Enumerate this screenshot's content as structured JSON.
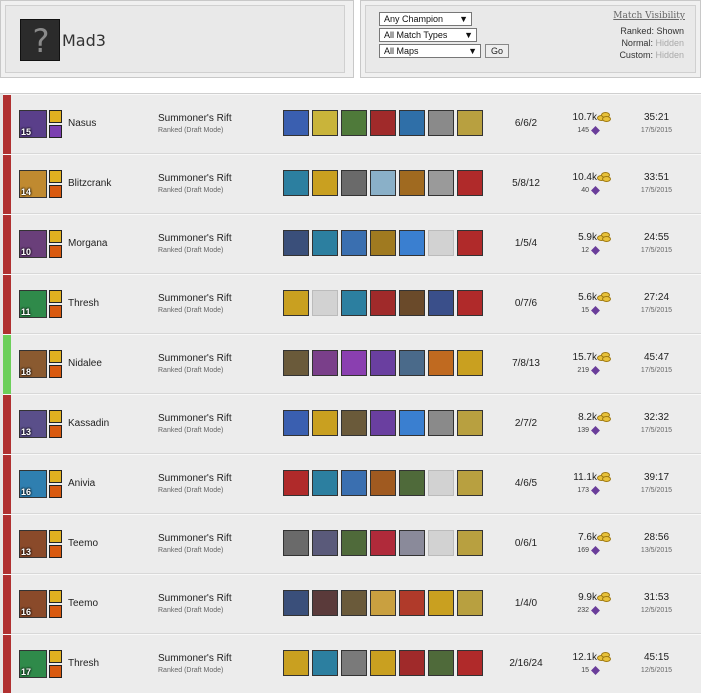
{
  "profile": {
    "name": "Mad3",
    "avatar_icon": "question-mark-icon"
  },
  "filters": {
    "champion": "Any Champion",
    "match_types": "All Match Types",
    "maps": "All Maps",
    "go_label": "Go"
  },
  "visibility": {
    "title": "Match Visibility",
    "ranked_label": "Ranked:",
    "ranked_value": "Shown",
    "normal_label": "Normal:",
    "normal_value": "Hidden",
    "custom_label": "Custom:",
    "custom_value": "Hidden"
  },
  "colors": {
    "loss": "#b03030",
    "win": "#6ccf5a"
  },
  "matches": [
    {
      "result": "loss",
      "champion": "Nasus",
      "level": "15",
      "mode": "Summoner's Rift",
      "queue": "Ranked (Draft Mode)",
      "kda": "6/6/2",
      "gold": "10.7k",
      "cs": "145",
      "duration": "35:21",
      "date": "17/5/2015",
      "champ_color": "#5a3f8a",
      "spells": [
        "#e0b020",
        "#7b3fb0"
      ],
      "items": [
        "#3a5fb0",
        "#c9b43a",
        "#4f7a3a",
        "#a02a2a",
        "#2f6fa8",
        "#8a8a8a",
        "#b8a040"
      ]
    },
    {
      "result": "loss",
      "champion": "Blitzcrank",
      "level": "14",
      "mode": "Summoner's Rift",
      "queue": "Ranked (Draft Mode)",
      "kda": "5/8/12",
      "gold": "10.4k",
      "cs": "40",
      "duration": "33:51",
      "date": "17/5/2015",
      "champ_color": "#c08a30",
      "spells": [
        "#e0b020",
        "#d85a10"
      ],
      "items": [
        "#2c7fa0",
        "#c9a020",
        "#6a6a6a",
        "#8ab0c8",
        "#a06a20",
        "#9a9a9a",
        "#b02a2a"
      ]
    },
    {
      "result": "loss",
      "champion": "Morgana",
      "level": "10",
      "mode": "Summoner's Rift",
      "queue": "Ranked (Draft Mode)",
      "kda": "1/5/4",
      "gold": "5.9k",
      "cs": "12",
      "duration": "24:55",
      "date": "17/5/2015",
      "champ_color": "#6a3f7a",
      "spells": [
        "#e0b020",
        "#d85a10"
      ],
      "items": [
        "#3a4f7a",
        "#2c7fa0",
        "#3a6fb0",
        "#a07a20",
        "#3a7fd0",
        null,
        "#b02a2a"
      ]
    },
    {
      "result": "loss",
      "champion": "Thresh",
      "level": "11",
      "mode": "Summoner's Rift",
      "queue": "Ranked (Draft Mode)",
      "kda": "0/7/6",
      "gold": "5.6k",
      "cs": "15",
      "duration": "27:24",
      "date": "17/5/2015",
      "champ_color": "#2f8a4a",
      "spells": [
        "#e0b020",
        "#d85a10"
      ],
      "items": [
        "#c9a020",
        null,
        "#2c7fa0",
        "#a02a2a",
        "#6a4a2a",
        "#3a4f8a",
        "#b02a2a"
      ]
    },
    {
      "result": "win",
      "champion": "Nidalee",
      "level": "18",
      "mode": "Summoner's Rift",
      "queue": "Ranked (Draft Mode)",
      "kda": "7/8/13",
      "gold": "15.7k",
      "cs": "219",
      "duration": "45:47",
      "date": "17/5/2015",
      "champ_color": "#8a5a30",
      "spells": [
        "#e0b020",
        "#d85a10"
      ],
      "items": [
        "#6a5a3a",
        "#7a3f8a",
        "#8a3fb0",
        "#6a3fa0",
        "#4a6a8a",
        "#c06a20",
        "#c9a020"
      ]
    },
    {
      "result": "loss",
      "champion": "Kassadin",
      "level": "13",
      "mode": "Summoner's Rift",
      "queue": "Ranked (Draft Mode)",
      "kda": "2/7/2",
      "gold": "8.2k",
      "cs": "139",
      "duration": "32:32",
      "date": "17/5/2015",
      "champ_color": "#5a4f8a",
      "spells": [
        "#e0b020",
        "#d85a10"
      ],
      "items": [
        "#3a5fb0",
        "#c9a020",
        "#6a5a3a",
        "#6a3fa0",
        "#3a7fd0",
        "#8a8a8a",
        "#b8a040"
      ]
    },
    {
      "result": "loss",
      "champion": "Anivia",
      "level": "16",
      "mode": "Summoner's Rift",
      "queue": "Ranked (Draft Mode)",
      "kda": "4/6/5",
      "gold": "11.1k",
      "cs": "173",
      "duration": "39:17",
      "date": "17/5/2015",
      "champ_color": "#2f7fb0",
      "spells": [
        "#e0b020",
        "#d85a10"
      ],
      "items": [
        "#b02a2a",
        "#2c7fa0",
        "#3a6fb0",
        "#a05a20",
        "#4f6a3a",
        null,
        "#b8a040"
      ]
    },
    {
      "result": "loss",
      "champion": "Teemo",
      "level": "13",
      "mode": "Summoner's Rift",
      "queue": "Ranked (Draft Mode)",
      "kda": "0/6/1",
      "gold": "7.6k",
      "cs": "169",
      "duration": "28:56",
      "date": "13/5/2015",
      "champ_color": "#8a4a2a",
      "spells": [
        "#e0b020",
        "#d85a10"
      ],
      "items": [
        "#6a6a6a",
        "#5a5a7a",
        "#4f6a3a",
        "#b02a3a",
        "#8a8a9a",
        null,
        "#b8a040"
      ]
    },
    {
      "result": "loss",
      "champion": "Teemo",
      "level": "16",
      "mode": "Summoner's Rift",
      "queue": "Ranked (Draft Mode)",
      "kda": "1/4/0",
      "gold": "9.9k",
      "cs": "232",
      "duration": "31:53",
      "date": "12/5/2015",
      "champ_color": "#8a4a2a",
      "spells": [
        "#e0b020",
        "#d85a10"
      ],
      "items": [
        "#3a4f7a",
        "#5a3a3a",
        "#6a5a3a",
        "#c9a040",
        "#b03a2a",
        "#c9a020",
        "#b8a040"
      ]
    },
    {
      "result": "loss",
      "champion": "Thresh",
      "level": "17",
      "mode": "Summoner's Rift",
      "queue": "Ranked (Draft Mode)",
      "kda": "2/16/24",
      "gold": "12.1k",
      "cs": "15",
      "duration": "45:15",
      "date": "12/5/2015",
      "champ_color": "#2f8a4a",
      "spells": [
        "#e0b020",
        "#d85a10"
      ],
      "items": [
        "#c9a020",
        "#2c7fa0",
        "#7a7a7a",
        "#c9a020",
        "#a02a2a",
        "#4f6a3a",
        "#b02a2a"
      ]
    }
  ]
}
